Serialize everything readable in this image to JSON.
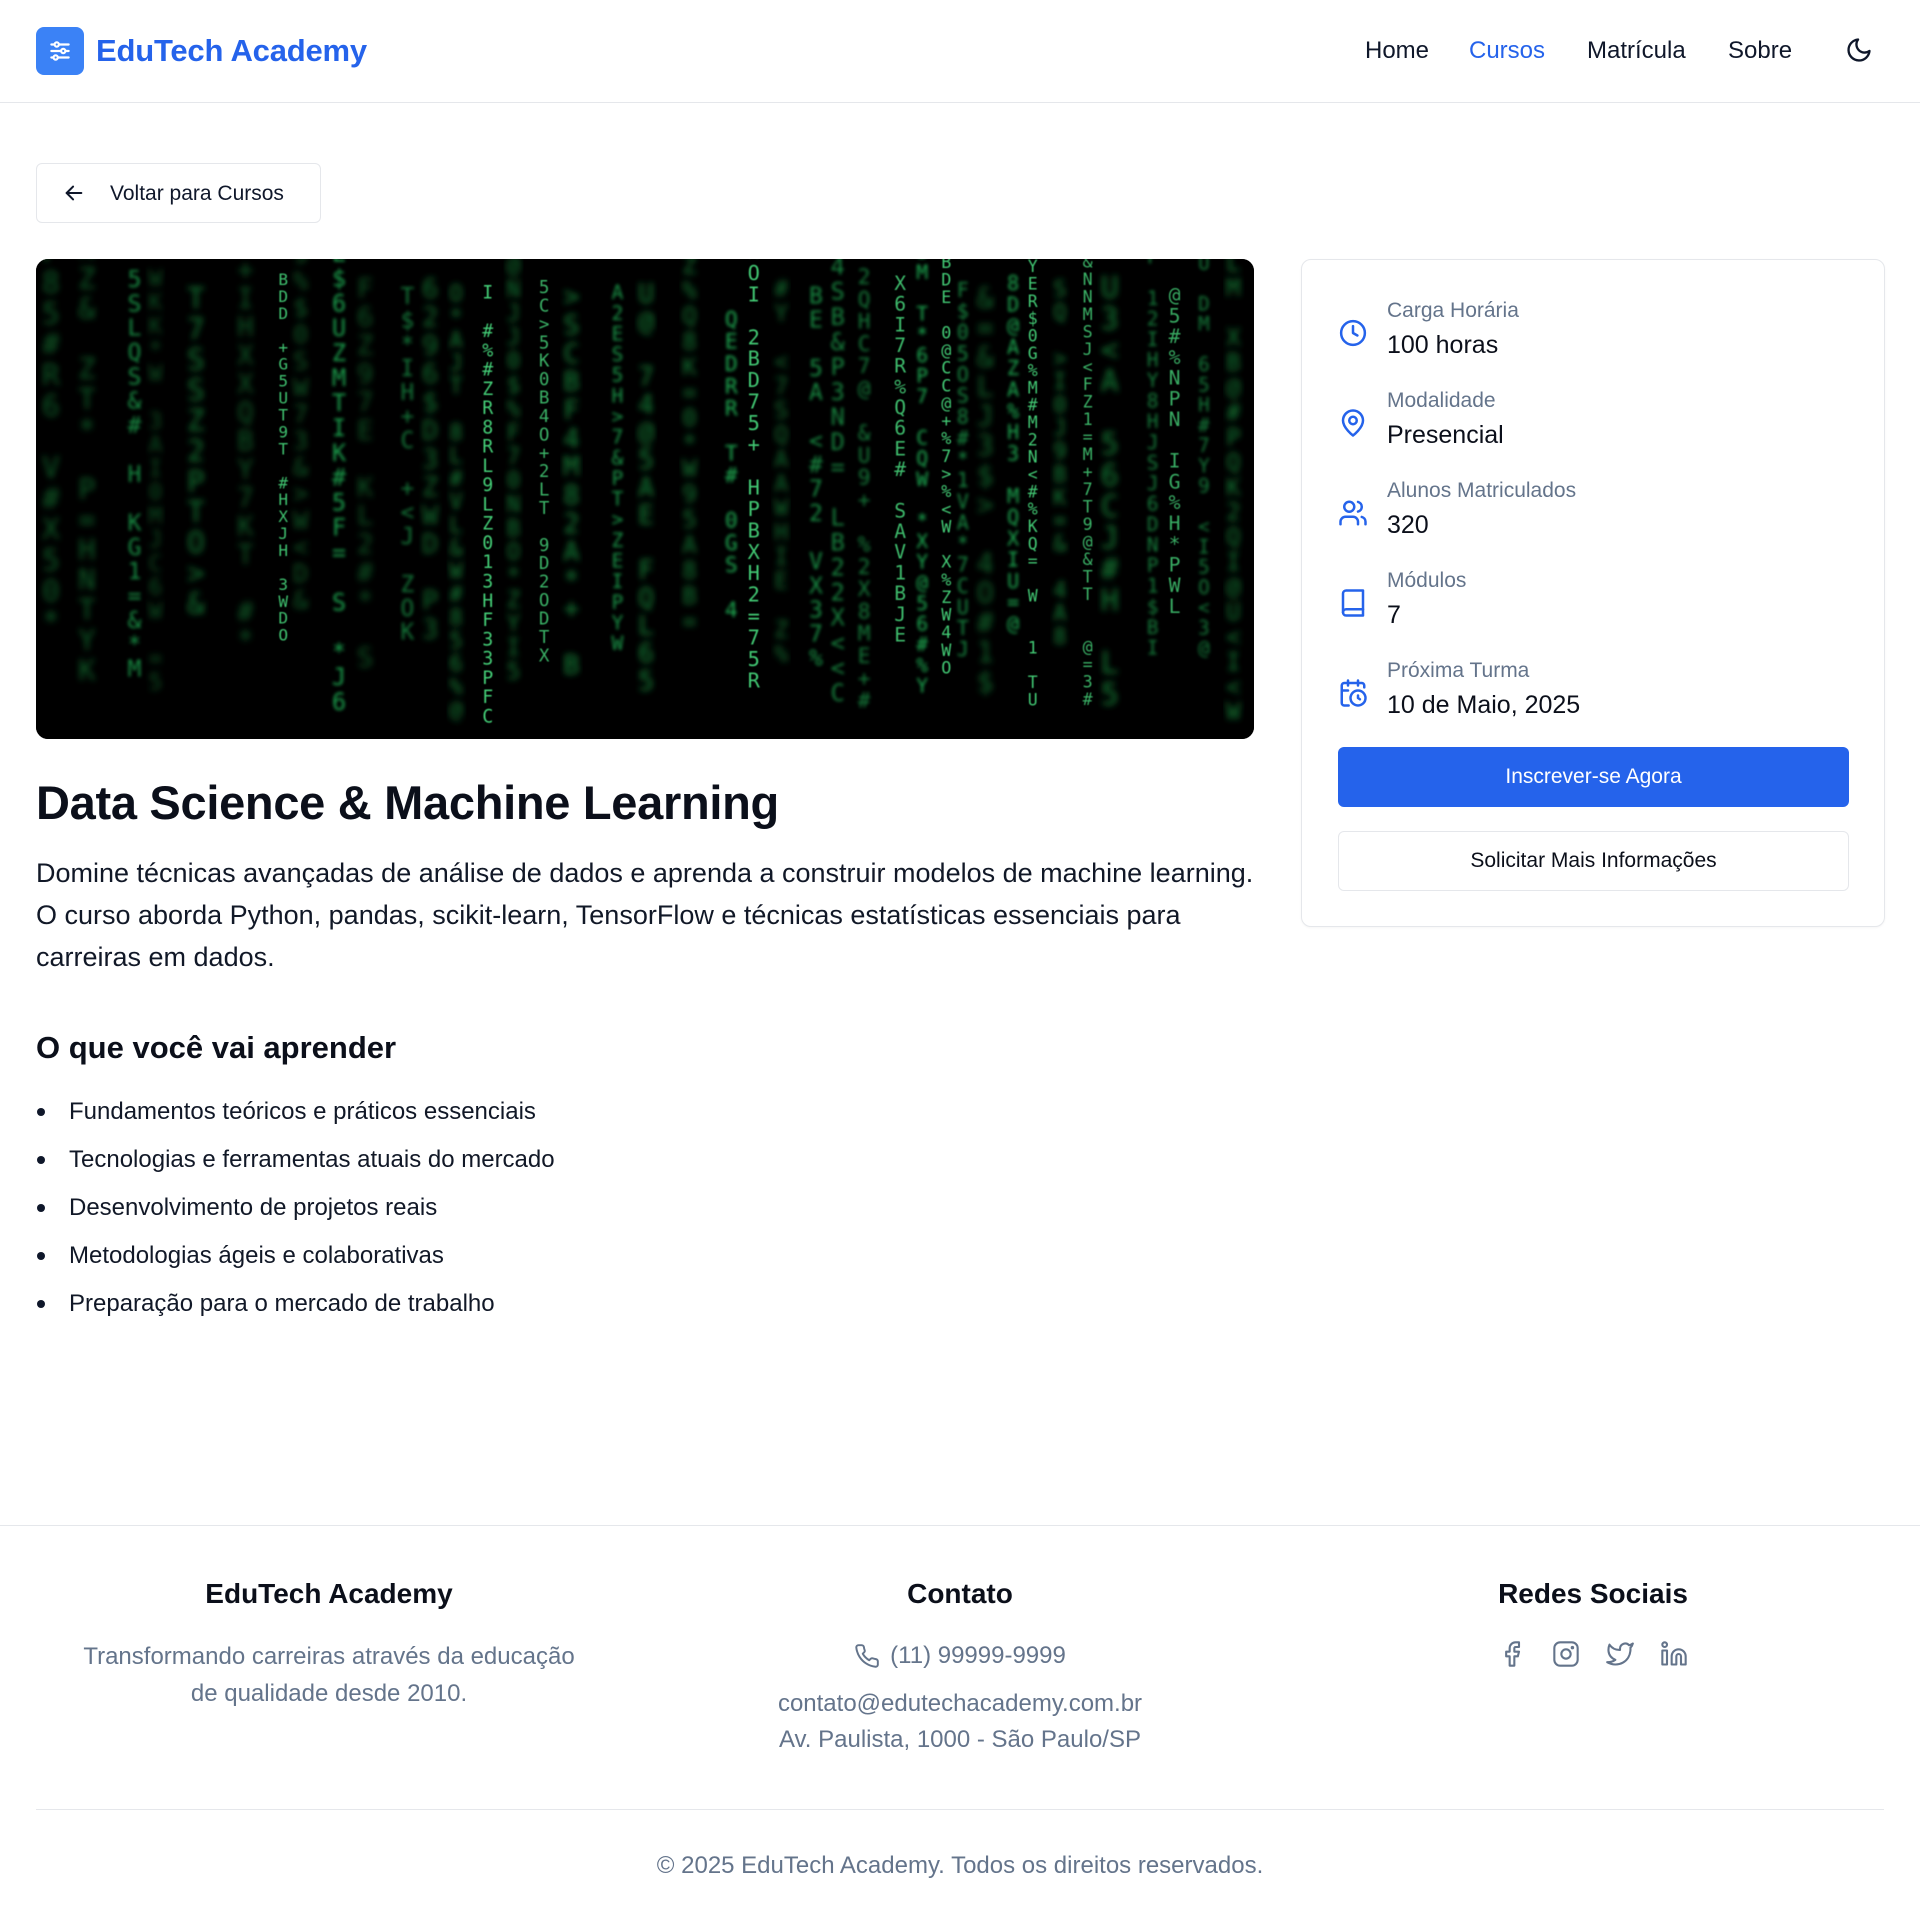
{
  "header": {
    "brand": "EduTech Academy",
    "logo_icon": "sliders-icon",
    "nav": [
      {
        "label": "Home",
        "active": false
      },
      {
        "label": "Cursos",
        "active": true
      },
      {
        "label": "Matrícula",
        "active": false
      },
      {
        "label": "Sobre",
        "active": false
      }
    ],
    "theme_icon": "moon-icon"
  },
  "back_button": {
    "label": "Voltar para Cursos",
    "icon": "arrow-left-icon"
  },
  "hero": {
    "image": "matrix-green-code-image"
  },
  "course": {
    "title": "Data Science & Machine Learning",
    "description": "Domine técnicas avançadas de análise de dados e aprenda a construir modelos de machine learning. O curso aborda Python, pandas, scikit-learn, TensorFlow e técnicas estatísticas essenciais para carreiras em dados.",
    "learn_title": "O que você vai aprender",
    "learn_items": [
      "Fundamentos teóricos e práticos essenciais",
      "Tecnologias e ferramentas atuais do mercado",
      "Desenvolvimento de projetos reais",
      "Metodologias ágeis e colaborativas",
      "Preparação para o mercado de trabalho"
    ]
  },
  "sidebar": {
    "info": [
      {
        "label": "Carga Horária",
        "value": "100 horas",
        "icon": "clock-icon"
      },
      {
        "label": "Modalidade",
        "value": "Presencial",
        "icon": "map-pin-icon"
      },
      {
        "label": "Alunos Matriculados",
        "value": "320",
        "icon": "users-icon"
      },
      {
        "label": "Módulos",
        "value": "7",
        "icon": "book-icon"
      },
      {
        "label": "Próxima Turma",
        "value": "10 de Maio, 2025",
        "icon": "calendar-clock-icon"
      }
    ],
    "enroll_button": "Inscrever-se Agora",
    "info_button": "Solicitar Mais Informações"
  },
  "footer": {
    "about_title": "EduTech Academy",
    "about_text": "Transformando carreiras através da educação de qualidade desde 2010.",
    "contact_title": "Contato",
    "phone": "(11) 99999-9999",
    "email": "contato@edutechacademy.com.br",
    "address": "Av. Paulista, 1000 - São Paulo/SP",
    "social_title": "Redes Sociais",
    "social": [
      "facebook-icon",
      "instagram-icon",
      "twitter-icon",
      "linkedin-icon"
    ],
    "copyright": "© 2025 EduTech Academy. Todos os direitos reservados."
  },
  "colors": {
    "accent": "#2563eb",
    "accent_light": "#3b82f6",
    "muted_text": "#64748b",
    "border": "#e5e7eb",
    "matrix_green": "#22c55e"
  }
}
